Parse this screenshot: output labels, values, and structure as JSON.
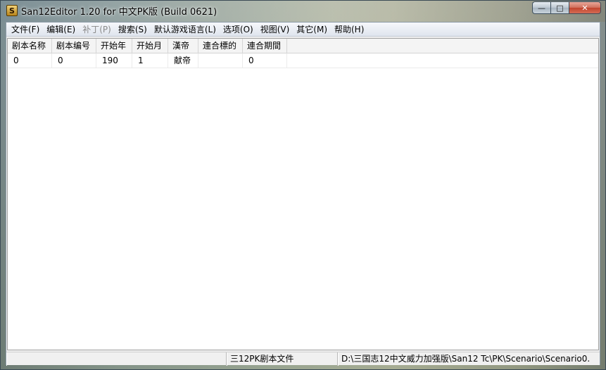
{
  "window": {
    "title": "San12Editor 1.20 for 中文PK版 (Build 0621)",
    "icon_glyph": "S",
    "controls": {
      "minimize": "—",
      "maximize": "□",
      "close": "✕"
    }
  },
  "menubar": {
    "items": [
      {
        "label": "文件(F)",
        "enabled": true
      },
      {
        "label": "编辑(E)",
        "enabled": true
      },
      {
        "label": "补丁(P)",
        "enabled": false
      },
      {
        "label": "搜索(S)",
        "enabled": true
      },
      {
        "label": "默认游戏语言(L)",
        "enabled": true
      },
      {
        "label": "选项(O)",
        "enabled": true
      },
      {
        "label": "视图(V)",
        "enabled": true
      },
      {
        "label": "其它(M)",
        "enabled": true
      },
      {
        "label": "帮助(H)",
        "enabled": true
      }
    ]
  },
  "grid": {
    "columns": [
      "剧本名称",
      "剧本编号",
      "开始年",
      "开始月",
      "漢帝",
      "連合標的",
      "連合期間"
    ],
    "rows": [
      [
        "0",
        "0",
        "190",
        "1",
        "献帝",
        "",
        "0"
      ]
    ]
  },
  "statusbar": {
    "panels": [
      "",
      "三12PK剧本文件",
      "D:\\三国志12中文威力加强版\\San12 Tc\\PK\\Scenario\\Scenario0."
    ]
  }
}
